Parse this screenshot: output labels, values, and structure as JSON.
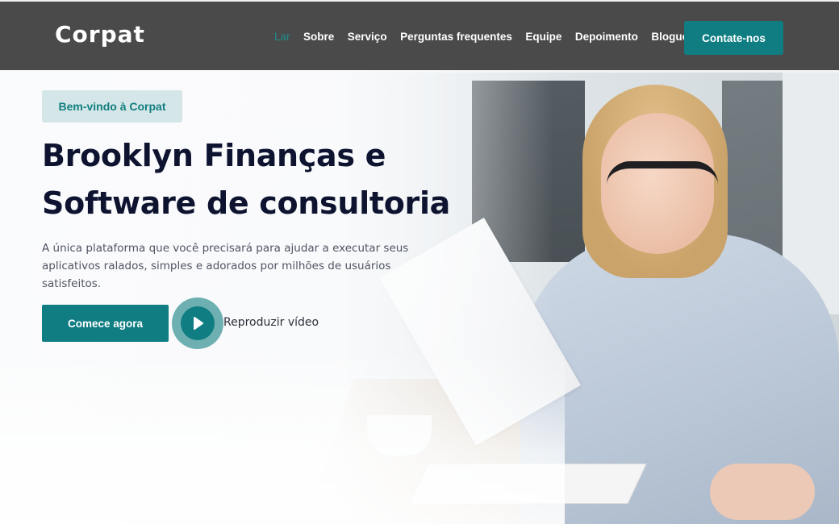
{
  "brand": {
    "logo": "Corpat",
    "accent": "#0f7d82"
  },
  "nav": {
    "items": [
      {
        "label": "Lar",
        "active": true
      },
      {
        "label": "Sobre"
      },
      {
        "label": "Serviço"
      },
      {
        "label": "Perguntas frequentes"
      },
      {
        "label": "Equipe"
      },
      {
        "label": "Depoimento"
      },
      {
        "label": "Blogue"
      }
    ],
    "cta": "Contate-nos"
  },
  "hero": {
    "badge": "Bem-vindo à Corpat",
    "title_line1": "Brooklyn Finanças e",
    "title_line2": "Software de consultoria",
    "subtitle_line1": "A única plataforma que você precisará para ajudar a executar seus",
    "subtitle_line2": "aplicativos ralados, simples e adorados por milhões de usuários satisfeitos.",
    "primary_button": "Comece agora",
    "video_label": "Reproduzir vídeo",
    "play_icon": "play-icon"
  }
}
